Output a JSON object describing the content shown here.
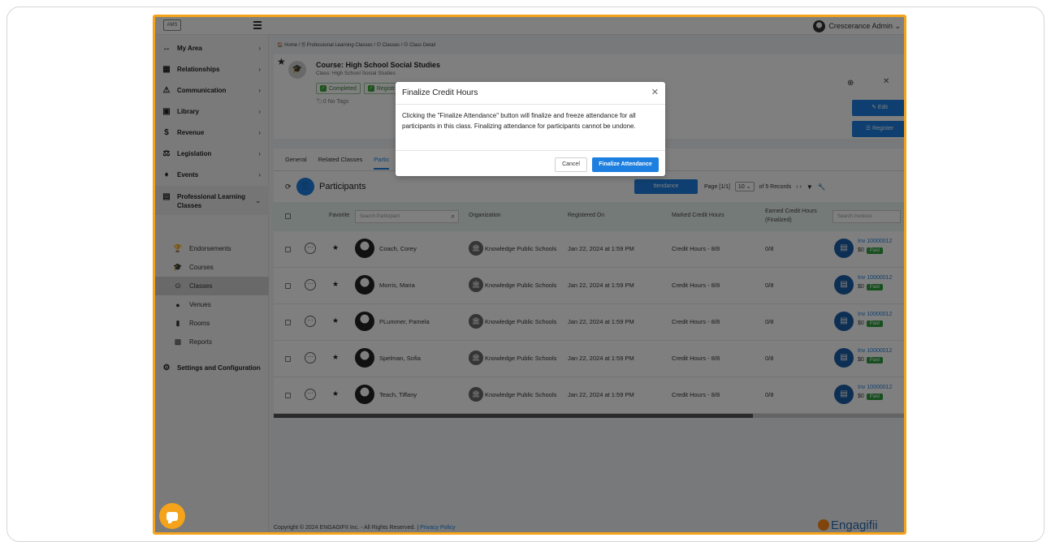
{
  "topbar": {
    "admin_name": "Crescerance Admin ⌄"
  },
  "sidebar": {
    "items": [
      {
        "icon": "↔",
        "label": "My Area"
      },
      {
        "icon": "▦",
        "label": "Relationships"
      },
      {
        "icon": "⚠",
        "label": "Communication"
      },
      {
        "icon": "▣",
        "label": "Library"
      },
      {
        "icon": "$",
        "label": "Revenue"
      },
      {
        "icon": "⚖",
        "label": "Legislation"
      },
      {
        "icon": "♦",
        "label": "Events"
      },
      {
        "icon": "▤",
        "label": "Professional Learning Classes"
      },
      {
        "icon": "⚙",
        "label": "Settings and Configuration"
      }
    ],
    "sub_items": [
      {
        "icon": "🏆",
        "label": "Endorsements"
      },
      {
        "icon": "🎓",
        "label": "Courses"
      },
      {
        "icon": "⊙",
        "label": "Classes"
      },
      {
        "icon": "●",
        "label": "Venues"
      },
      {
        "icon": "▮",
        "label": "Rooms"
      },
      {
        "icon": "▩",
        "label": "Reports"
      }
    ]
  },
  "breadcrumb": "🏠 Home  /  🗎 Professional Learning Classes  /  ⊙ Classes  /  ⊙ Class Detail",
  "header": {
    "course_title": "Course: High School Social Studies",
    "class_subtitle": "Class: High School Social Studies",
    "badge_completed": "Completed",
    "badge_registered": "Registr",
    "tags": "🏷0  No Tags",
    "edit_label": "✎ Edit",
    "register_label": "☰ Register"
  },
  "tabs": [
    "General",
    "Related Classes",
    "Partic"
  ],
  "participants": {
    "title": "Participants",
    "attendance_label": "ttendance",
    "page_label": "Page [1/1]",
    "page_size": "10",
    "records": "of 5 Records",
    "nav_arrows": "‹  ›",
    "filter_glyph": "▼",
    "wrench_glyph": "🔧"
  },
  "table": {
    "headers": {
      "favorite": "Favorite",
      "search_placeholder": "Search Participant",
      "organization": "Organization",
      "registered_on": "Registered On",
      "marked_credit": "Marked Credit Hours",
      "earned_credit": "Earned Credit Hours (Finalized)",
      "search_invoices": "Search Invoices"
    },
    "rows": [
      {
        "name": "Coach, Corey",
        "org": "Knowledge Public Schools",
        "registered": "Jan 22, 2024 at 1:59 PM",
        "marked": "Credit Hours - 8/8",
        "earned": "0/8",
        "invoice": "Inv 10000012",
        "amount": "$0",
        "status": "Paid"
      },
      {
        "name": "Morris, Maria",
        "org": "Knowledge Public Schools",
        "registered": "Jan 22, 2024 at 1:59 PM",
        "marked": "Credit Hours - 8/8",
        "earned": "0/8",
        "invoice": "Inv 10000012",
        "amount": "$0",
        "status": "Paid"
      },
      {
        "name": "PLummer, Pamela",
        "org": "Knowledge Public Schools",
        "registered": "Jan 22, 2024 at 1:59 PM",
        "marked": "Credit Hours - 8/8",
        "earned": "0/8",
        "invoice": "Inv 10000012",
        "amount": "$0",
        "status": "Paid"
      },
      {
        "name": "Spelman, Sofia",
        "org": "Knowledge Public Schools",
        "registered": "Jan 22, 2024 at 1:59 PM",
        "marked": "Credit Hours - 8/8",
        "earned": "0/8",
        "invoice": "Inv 10000012",
        "amount": "$0",
        "status": "Paid"
      },
      {
        "name": "Teach, Tiffany",
        "org": "Knowledge Public Schools",
        "registered": "Jan 22, 2024 at 1:59 PM",
        "marked": "Credit Hours - 8/8",
        "earned": "0/8",
        "invoice": "Inv 10000012",
        "amount": "$0",
        "status": "Paid"
      }
    ]
  },
  "footer": {
    "copyright": "Copyright © 2024 ENGAGIFII Inc. - All Rights Reserved. | ",
    "privacy": "Privacy Policy",
    "brand": "Engagifii"
  },
  "modal": {
    "title": "Finalize Credit Hours",
    "body": "Clicking the \"Finalize Attendance\" button will finalize and freeze attendance for all participants in this class. Finalizing attendance for participants cannot be undone.",
    "cancel_label": "Cancel",
    "confirm_label": "Finalize Attendance"
  },
  "colors": {
    "accent": "#1d7fe0",
    "frame": "#f5a31a",
    "paid": "#2e9e3f"
  }
}
